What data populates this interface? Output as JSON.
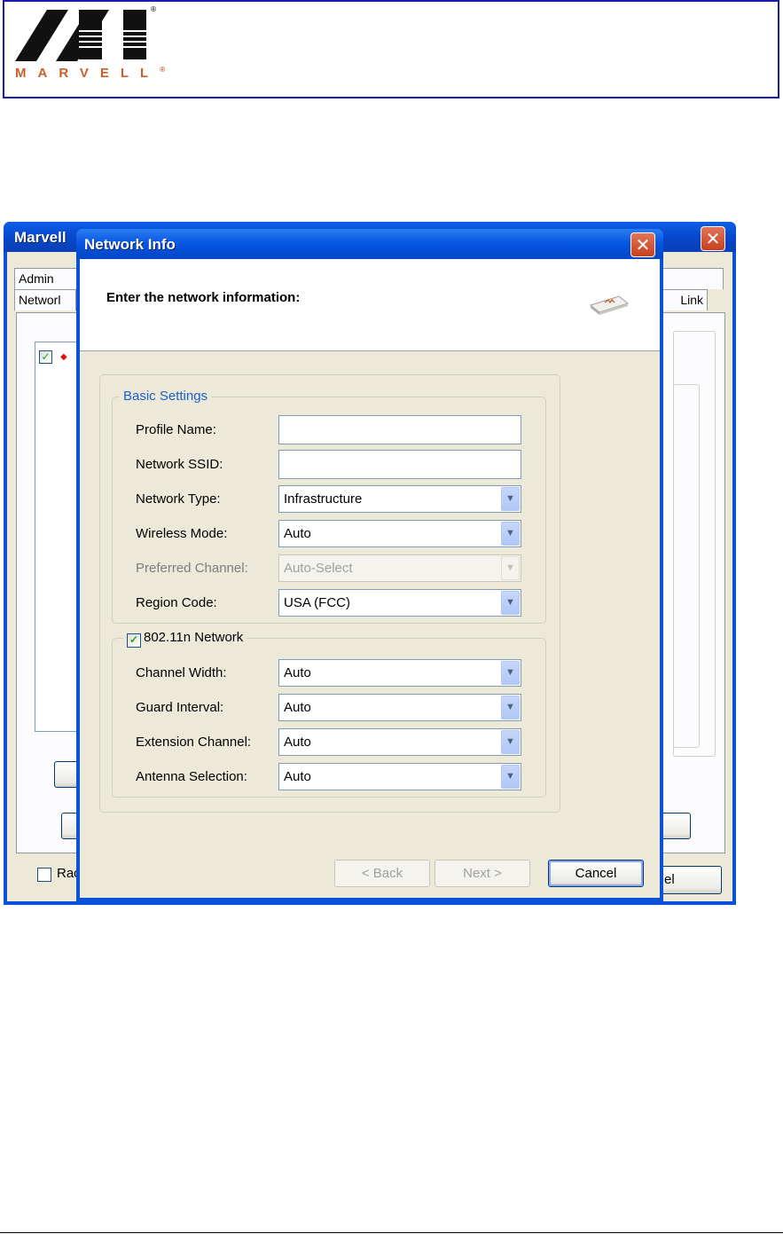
{
  "document": {
    "logo_text": "MARVELL",
    "logo_reg": "®"
  },
  "main_window": {
    "title": "Marvell",
    "tabs": [
      "Admin",
      "Networl",
      "Link"
    ],
    "checkbox_label": "Rac",
    "cancel_button": "el",
    "close_glyph": "✕"
  },
  "dialog": {
    "title": "Network Info",
    "heading": "Enter the network information:",
    "close_glyph": "✕",
    "basic": {
      "legend": "Basic Settings",
      "profile_name": {
        "label": "Profile Name:",
        "value": ""
      },
      "network_ssid": {
        "label": "Network SSID:",
        "value": ""
      },
      "network_type": {
        "label": "Network Type:",
        "value": "Infrastructure"
      },
      "wireless_mode": {
        "label": "Wireless Mode:",
        "value": "Auto"
      },
      "preferred_channel": {
        "label": "Preferred Channel:",
        "value": "Auto-Select"
      },
      "region_code": {
        "label": "Region Code:",
        "value": "USA (FCC)"
      }
    },
    "n_network": {
      "legend": "802.11n Network",
      "checked": true,
      "channel_width": {
        "label": "Channel Width:",
        "value": "Auto"
      },
      "guard_interval": {
        "label": "Guard Interval:",
        "value": "Auto"
      },
      "extension_channel": {
        "label": "Extension Channel:",
        "value": "Auto"
      },
      "antenna_selection": {
        "label": "Antenna Selection:",
        "value": "Auto"
      }
    },
    "buttons": {
      "back": "< Back",
      "next": "Next >",
      "cancel": "Cancel"
    }
  },
  "icons": {
    "dropdown": "chevron-down-icon",
    "check": "checkmark-icon"
  },
  "colors": {
    "title_bar": "#0a53d8",
    "header_border": "#1a1ab0",
    "logo": "#c8602e",
    "legend_blue": "#1a5fd0"
  }
}
